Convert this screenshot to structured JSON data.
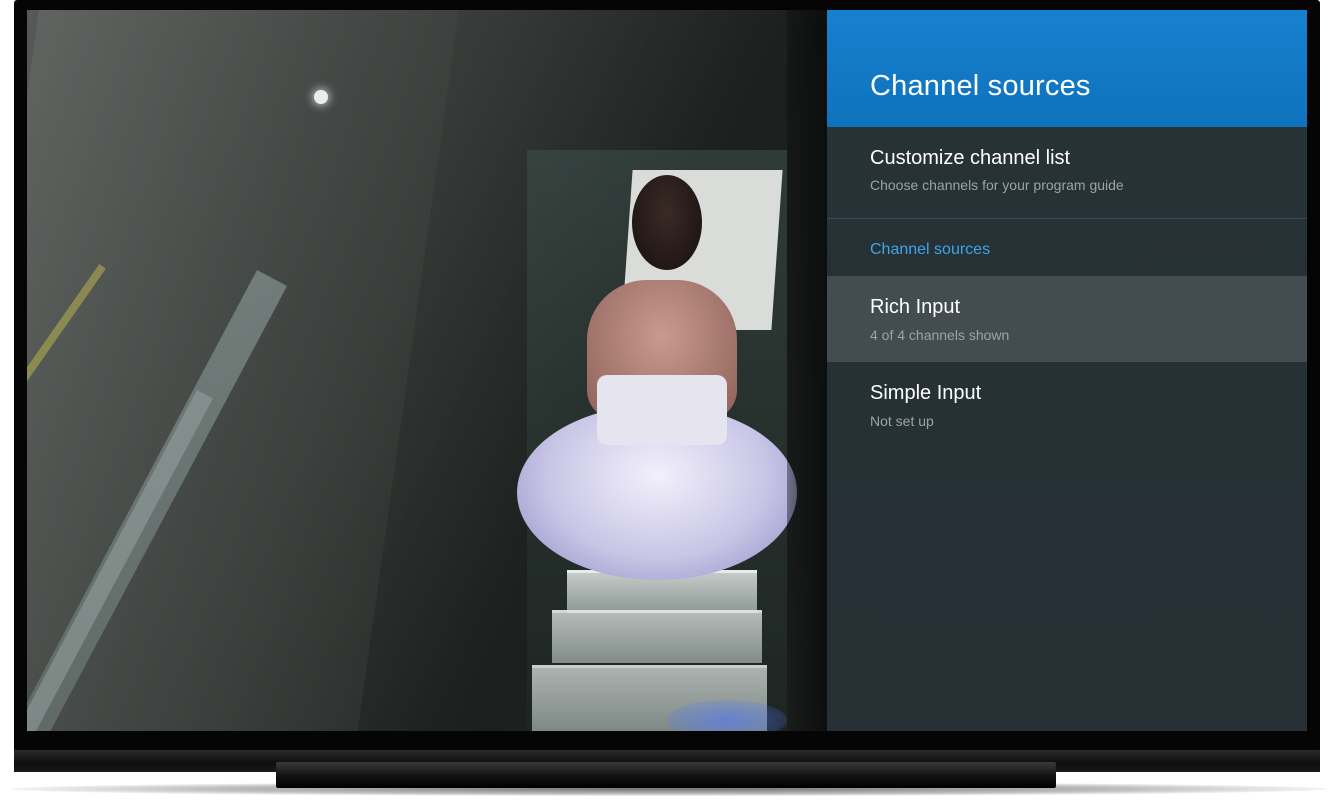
{
  "panel": {
    "title": "Channel sources",
    "customize": {
      "title": "Customize channel list",
      "subtitle": "Choose channels for your program guide"
    },
    "section_label": "Channel sources",
    "sources": [
      {
        "title": "Rich Input",
        "subtitle": "4 of 4 channels shown",
        "selected": true
      },
      {
        "title": "Simple Input",
        "subtitle": "Not set up",
        "selected": false
      }
    ]
  },
  "colors": {
    "header_blue": "#1479c4",
    "panel_bg": "#273237",
    "selected_row": "#434d51",
    "section_label": "#3da5e8"
  }
}
